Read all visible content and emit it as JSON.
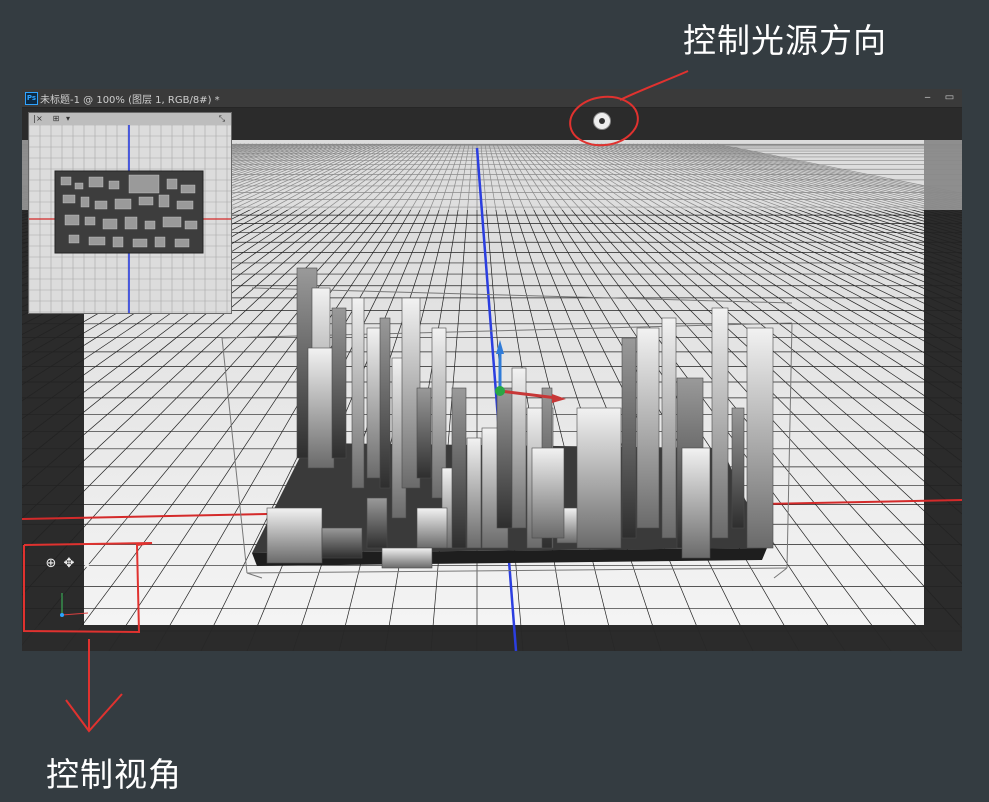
{
  "annotations": {
    "light_direction": "控制光源方向",
    "view_angle": "控制视角"
  },
  "document": {
    "app_badge": "Ps",
    "title": "未标题-1 @ 100% (图层 1, RGB/8#) *",
    "minimize_glyph": "‒",
    "maximize_glyph": "▭"
  },
  "minimap": {
    "close_glyph": "|×",
    "add_glyph": "⊞",
    "arrow_glyph": "▾",
    "expand_glyph": "⤡"
  },
  "camera_controls": {
    "orbit_glyph": "⊕",
    "pan_glyph": "✥",
    "dolly_glyph": "⬍"
  },
  "colors": {
    "background": "#343c41",
    "annotation_red": "#e0322f",
    "axis_red": "#d42a2a",
    "axis_blue": "#2b3ee0",
    "axis_green": "#28a745"
  },
  "icons": [
    "light-source-icon",
    "orbit-icon",
    "pan-icon",
    "dolly-icon",
    "close-icon",
    "expand-icon"
  ]
}
